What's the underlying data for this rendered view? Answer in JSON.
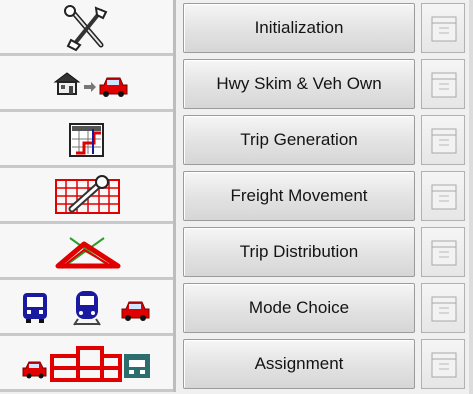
{
  "window": {
    "accent_red": "#e00000",
    "accent_blue": "#1a1aa0"
  },
  "steps": [
    {
      "label": "Initialization",
      "icon": "tools-icon"
    },
    {
      "label": "Hwy Skim & Veh Own",
      "icon": "house-to-car-icon"
    },
    {
      "label": "Trip Generation",
      "icon": "trip-generation-icon"
    },
    {
      "label": "Freight Movement",
      "icon": "freight-wrench-grid-icon"
    },
    {
      "label": "Trip Distribution",
      "icon": "trip-distribution-triangle-icon"
    },
    {
      "label": "Mode Choice",
      "icon": "bus-train-car-icon"
    },
    {
      "label": "Assignment",
      "icon": "car-network-icon"
    }
  ]
}
